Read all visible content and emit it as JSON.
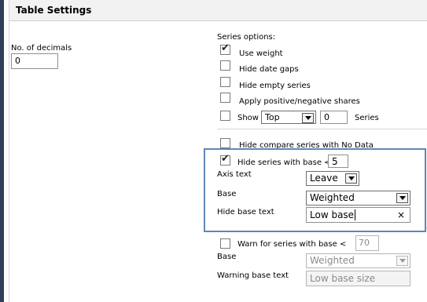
{
  "header": {
    "title": "Table Settings"
  },
  "decimals": {
    "label": "No. of decimals",
    "value": "0"
  },
  "series_options": {
    "title": "Series options:",
    "use_weight": "Use weight",
    "hide_date_gaps": "Hide date gaps",
    "hide_empty_series": "Hide empty series",
    "apply_shares": "Apply positive/negative shares",
    "show_label": "Show",
    "show_select_value": "Top",
    "show_count": "0",
    "series_label": "Series",
    "hide_compare": "Hide compare series with No Data",
    "hide_base_label": "Hide series with base <",
    "hide_base_value": "5"
  },
  "highlighted_group": {
    "axis_text_label": "Axis text",
    "axis_text_value": "Leave",
    "base_label": "Base",
    "base_value": "Weighted",
    "hide_base_text_label": "Hide base text",
    "hide_base_text_value": "Low base",
    "clear_icon": "×"
  },
  "warn": {
    "label": "Warn for series with base <",
    "value": "70",
    "base_label": "Base",
    "base_value": "Weighted",
    "warning_text_label": "Warning base text",
    "warning_text_value": "Low base size"
  },
  "colors": {
    "highlight_border": "#5f87b8",
    "left_bar": "#2c3e5a"
  }
}
